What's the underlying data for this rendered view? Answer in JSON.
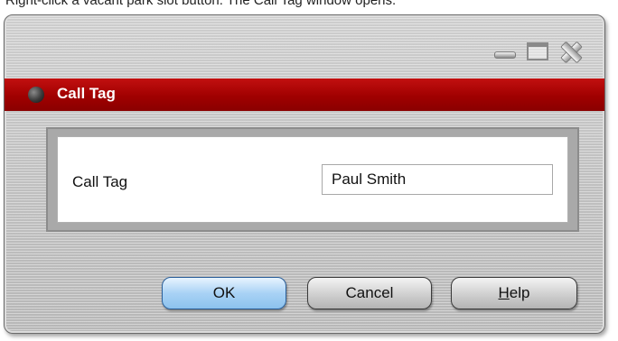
{
  "caption": {
    "text": "Right-click a vacant park slot button. The Call Tag window opens."
  },
  "window": {
    "title": "Call Tag",
    "controls": {
      "minimize_icon": "minimize-icon",
      "maximize_icon": "maximize-icon",
      "close_icon": "close-icon"
    },
    "title_bar_color": "#a00000"
  },
  "form": {
    "call_tag_label": "Call Tag",
    "call_tag_value": "Paul Smith"
  },
  "buttons": {
    "ok": "OK",
    "cancel": "Cancel",
    "help_mnemonic": "H",
    "help_rest": "elp"
  },
  "colors": {
    "ok_button": "#a9d2f5",
    "window_background": "#c6c6c6"
  }
}
